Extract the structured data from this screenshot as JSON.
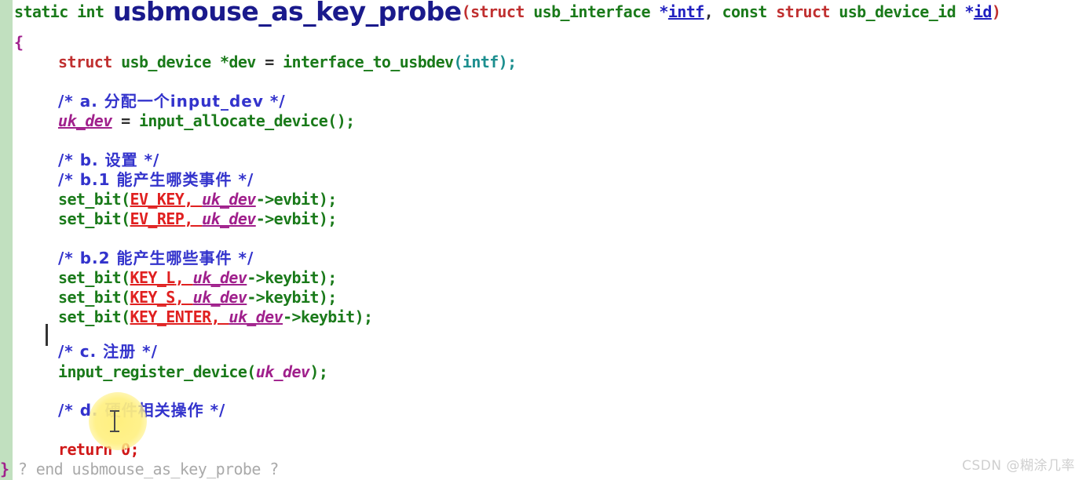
{
  "editor": {
    "gutter_color": "#c1e0bf",
    "background_color": "#ffffff",
    "caret_visible": true
  },
  "colors": {
    "keyword": "#1a7a1a",
    "struct_keyword": "#c03030",
    "identifier": "#1a7a1a",
    "variable": "#2020c0",
    "member": "#a0208c",
    "macro": "#e02020",
    "comment": "#3333cc",
    "return": "#d01818",
    "brace": "#a0208c",
    "fold_marker": "#aaaaaa",
    "function_name": "#1a1a8c",
    "click_highlight": "#ffee78"
  },
  "code": {
    "signature": {
      "static": "static",
      "int": "int",
      "function_name": "usbmouse_as_key_probe",
      "paren_open": "(",
      "struct1": "struct",
      "type1": "usb_interface",
      "star1": "*",
      "arg1": "intf",
      "comma1": ", ",
      "const": "const",
      "struct2": "struct",
      "type2": "usb_device_id",
      "star2": "*",
      "arg2": "id",
      "paren_close": ")"
    },
    "open_brace": "{",
    "close_brace": "}",
    "line_dev_decl": {
      "struct": "struct",
      "type": "usb_device",
      "star_var": "*dev",
      "equals": " = ",
      "call": "interface_to_usbdev",
      "args": "(intf);"
    },
    "comment_a": "/* a. 分配一个input_dev */",
    "line_allocate": {
      "lhs": "uk_dev",
      "equals": " = ",
      "call": "input_allocate_device",
      "args": "();"
    },
    "comment_b": "/* b. 设置 */",
    "comment_b1": "/* b.1 能产生哪类事件 */",
    "setbit_evkey": {
      "fn": "set_bit",
      "open": "(",
      "macro": "EV_KEY",
      "sep": ", ",
      "obj": "uk_dev",
      "field": "->evbit",
      "close": ");"
    },
    "setbit_evrep": {
      "fn": "set_bit",
      "open": "(",
      "macro": "EV_REP",
      "sep": ", ",
      "obj": "uk_dev",
      "field": "->evbit",
      "close": ");"
    },
    "comment_b2": "/* b.2 能产生哪些事件 */",
    "setbit_keyl": {
      "fn": "set_bit",
      "open": "(",
      "macro": "KEY_L",
      "sep": ", ",
      "obj": "uk_dev",
      "field": "->keybit",
      "close": ");"
    },
    "setbit_keys": {
      "fn": "set_bit",
      "open": "(",
      "macro": "KEY_S",
      "sep": ", ",
      "obj": "uk_dev",
      "field": "->keybit",
      "close": ");"
    },
    "setbit_keyenter": {
      "fn": "set_bit",
      "open": "(",
      "macro": "KEY_ENTER",
      "sep": ", ",
      "obj": "uk_dev",
      "field": "->keybit",
      "close": ");"
    },
    "comment_c": "/* c. 注册 */",
    "line_register": {
      "call": "input_register_device",
      "open": "(",
      "arg": "uk_dev",
      "close": ");"
    },
    "comment_d": "/* d. 硬件相关操作 */",
    "line_return": {
      "keyword": "return",
      "value": " 0;"
    },
    "fold_marker": " ? end usbmouse_as_key_probe ?"
  },
  "watermark": {
    "text": "CSDN @糊涂几率"
  }
}
